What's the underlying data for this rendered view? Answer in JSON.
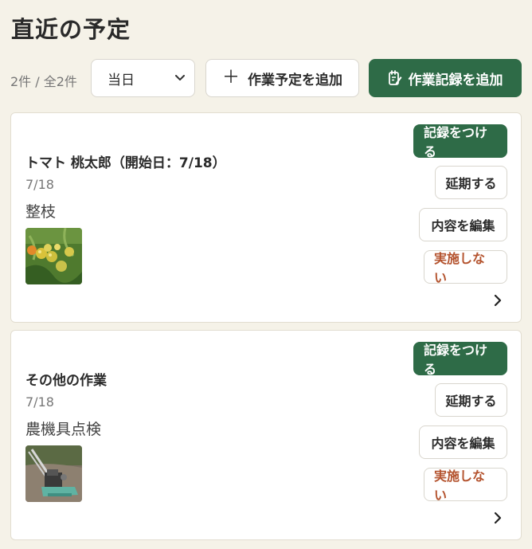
{
  "header": {
    "title": "直近の予定",
    "count": "2件 / 全2件",
    "filter_selected": "当日",
    "add_plan_label": "作業予定を追加",
    "add_record_label": "作業記録を追加"
  },
  "cards": [
    {
      "title": "トマト 桃太郎（開始日：7/18）",
      "date": "7/18",
      "task": "整枝",
      "image": "tomato-photo",
      "actions": {
        "record": "記録をつける",
        "postpone": "延期する",
        "edit": "内容を編集",
        "skip": "実施しない"
      }
    },
    {
      "title": "その他の作業",
      "date": "7/18",
      "task": "農機具点検",
      "image": "machine-photo",
      "actions": {
        "record": "記録をつける",
        "postpone": "延期する",
        "edit": "内容を編集",
        "skip": "実施しない"
      }
    }
  ],
  "colors": {
    "background": "#f5f2e8",
    "primary": "#2e6b47",
    "danger_text": "#b4532e"
  },
  "icons": {
    "select": "chevron-down-icon",
    "add_plan": "plus-icon",
    "add_record": "edit-note-icon",
    "card_link": "chevron-right-icon"
  }
}
